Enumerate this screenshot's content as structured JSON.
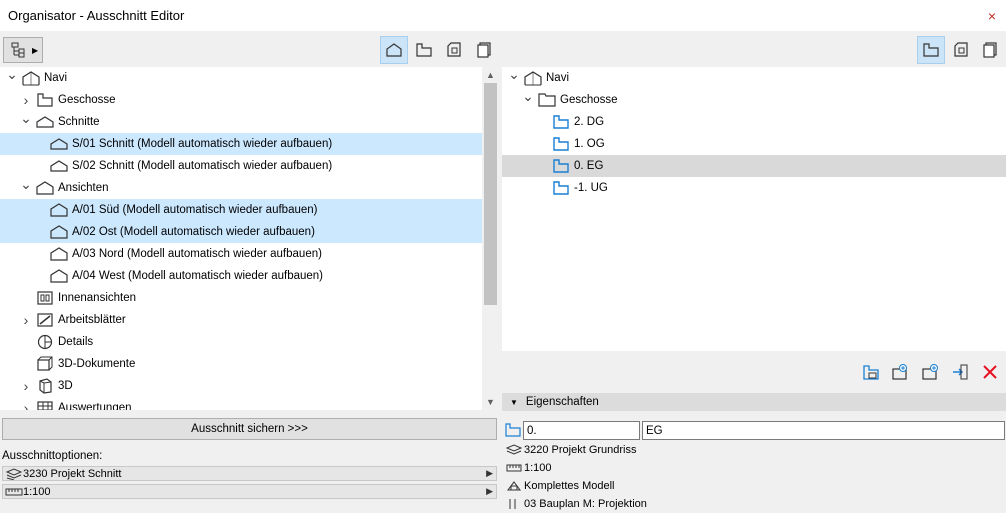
{
  "window": {
    "title": "Organisator - Ausschnitt Editor",
    "close_glyph": "×"
  },
  "left_toolbar": {
    "dropdown_icon": "tree-structure-icon",
    "tabs": [
      {
        "icon": "section-house-icon",
        "active": true
      },
      {
        "icon": "story-icon",
        "active": false
      },
      {
        "icon": "layout-icon",
        "active": false
      },
      {
        "icon": "publisher-icon",
        "active": false
      }
    ]
  },
  "right_toolbar": {
    "tabs": [
      {
        "icon": "story-icon",
        "active": true
      },
      {
        "icon": "layout-icon",
        "active": false
      },
      {
        "icon": "publisher-icon",
        "active": false
      }
    ]
  },
  "left_tree": [
    {
      "label": "Navi",
      "level": 0,
      "chevron": "v",
      "icon": "house",
      "state": "normal"
    },
    {
      "label": "Geschosse",
      "level": 1,
      "chevron": ">",
      "icon": "story",
      "state": "normal"
    },
    {
      "label": "Schnitte",
      "level": 1,
      "chevron": "v",
      "icon": "section",
      "state": "normal"
    },
    {
      "label": "S/01 Schnitt (Modell automatisch wieder aufbauen)",
      "level": 2,
      "chevron": "",
      "icon": "section",
      "state": "selected"
    },
    {
      "label": "S/02 Schnitt (Modell automatisch wieder aufbauen)",
      "level": 2,
      "chevron": "",
      "icon": "section",
      "state": "normal"
    },
    {
      "label": "Ansichten",
      "level": 1,
      "chevron": "v",
      "icon": "elevation",
      "state": "normal"
    },
    {
      "label": "A/01 Süd (Modell automatisch wieder aufbauen)",
      "level": 2,
      "chevron": "",
      "icon": "elevation",
      "state": "selected"
    },
    {
      "label": "A/02 Ost (Modell automatisch wieder aufbauen)",
      "level": 2,
      "chevron": "",
      "icon": "elevation",
      "state": "selected"
    },
    {
      "label": "A/03 Nord (Modell automatisch wieder aufbauen)",
      "level": 2,
      "chevron": "",
      "icon": "elevation",
      "state": "normal"
    },
    {
      "label": "A/04 West (Modell automatisch wieder aufbauen)",
      "level": 2,
      "chevron": "",
      "icon": "elevation",
      "state": "normal"
    },
    {
      "label": "Innenansichten",
      "level": 1,
      "chevron": "",
      "icon": "interior",
      "state": "normal"
    },
    {
      "label": "Arbeitsblätter",
      "level": 1,
      "chevron": ">",
      "icon": "worksheet",
      "state": "normal"
    },
    {
      "label": "Details",
      "level": 1,
      "chevron": "",
      "icon": "detail",
      "state": "normal"
    },
    {
      "label": "3D-Dokumente",
      "level": 1,
      "chevron": "",
      "icon": "doc3d",
      "state": "normal"
    },
    {
      "label": "3D",
      "level": 1,
      "chevron": ">",
      "icon": "cube",
      "state": "normal"
    },
    {
      "label": "Auswertungen",
      "level": 1,
      "chevron": ">",
      "icon": "schedule",
      "state": "normal"
    }
  ],
  "right_tree": [
    {
      "label": "Navi",
      "level": 0,
      "chevron": "v",
      "icon": "house",
      "state": "normal"
    },
    {
      "label": "Geschosse",
      "level": 1,
      "chevron": "v",
      "icon": "folder",
      "state": "normal"
    },
    {
      "label": "2. DG",
      "level": 2,
      "chevron": "",
      "icon": "story-blue",
      "state": "normal"
    },
    {
      "label": "1. OG",
      "level": 2,
      "chevron": "",
      "icon": "story-blue",
      "state": "normal"
    },
    {
      "label": "0. EG",
      "level": 2,
      "chevron": "",
      "icon": "story-blue",
      "state": "grey"
    },
    {
      "label": "-1. UG",
      "level": 2,
      "chevron": "",
      "icon": "story-blue",
      "state": "normal"
    }
  ],
  "save_button": "Ausschnitt sichern >>>",
  "options": {
    "label": "Ausschnittoptionen:",
    "fields": [
      {
        "icon": "layer-combination-icon",
        "value": "3230 Projekt Schnitt"
      },
      {
        "icon": "scale-icon",
        "value": "1:100"
      }
    ]
  },
  "actions": [
    {
      "icon": "new-folder-icon"
    },
    {
      "icon": "new-view-icon"
    },
    {
      "icon": "clone-folder-icon"
    },
    {
      "icon": "move-icon"
    },
    {
      "icon": "delete-icon"
    }
  ],
  "properties": {
    "header": "Eigenschaften",
    "id_value": "0.",
    "name_value": "EG",
    "lines": [
      {
        "icon": "layer-combination-icon",
        "text": "3220 Projekt Grundriss"
      },
      {
        "icon": "scale-icon",
        "text": "1:100"
      },
      {
        "icon": "structure-icon",
        "text": "Komplettes Modell"
      },
      {
        "icon": "pen-set-icon",
        "text": "03 Bauplan M: Projektion"
      }
    ]
  },
  "colors": {
    "selection": "#cce8ff",
    "grey_selection": "#d9d9d9",
    "active_tab": "#cce4f7",
    "accent_blue": "#1a7fd4",
    "delete_red": "#e81123"
  }
}
